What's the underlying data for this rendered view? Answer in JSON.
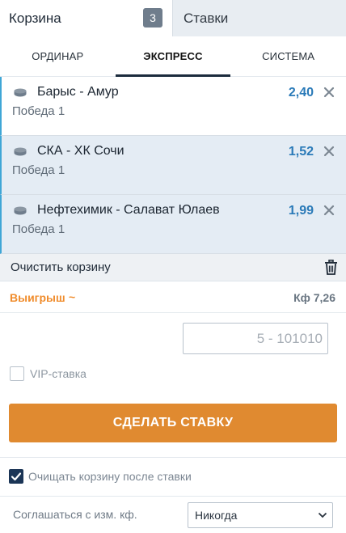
{
  "top_tabs": {
    "cart_label": "Корзина",
    "cart_count": "3",
    "bets_label": "Ставки"
  },
  "bet_types": [
    "ОРДИНАР",
    "ЭКСПРЕСС",
    "СИСТЕМА"
  ],
  "active_bet_type": "ЭКСПРЕСС",
  "bets": [
    {
      "match": "Барыс - Амур",
      "outcome": "Победа 1",
      "odds": "2,40",
      "icon": "hockey-puck-icon"
    },
    {
      "match": "СКА - ХК Сочи",
      "outcome": "Победа 1",
      "odds": "1,52",
      "icon": "hockey-puck-icon"
    },
    {
      "match": "Нефтехимик - Салават Юлаев",
      "outcome": "Победа 1",
      "odds": "1,99",
      "icon": "hockey-puck-icon"
    }
  ],
  "clear_cart_label": "Очистить корзину",
  "win": {
    "label": "Выигрыш",
    "tilde": "~",
    "coef": "Кф 7,26"
  },
  "stake": {
    "value": "",
    "placeholder": "5 - 101010"
  },
  "vip_label": "VIP-ставка",
  "place_bet_label": "СДЕЛАТЬ СТАВКУ",
  "clear_after_bet_label": "Очищать корзину после ставки",
  "agree": {
    "label": "Соглашаться с изм. кф.",
    "value": "Никогда"
  },
  "colors": {
    "accent_orange": "#e08a30",
    "odds_blue": "#2a7ab8",
    "selected_bg": "#e4ecf4",
    "checkbox_navy": "#1b3556"
  }
}
